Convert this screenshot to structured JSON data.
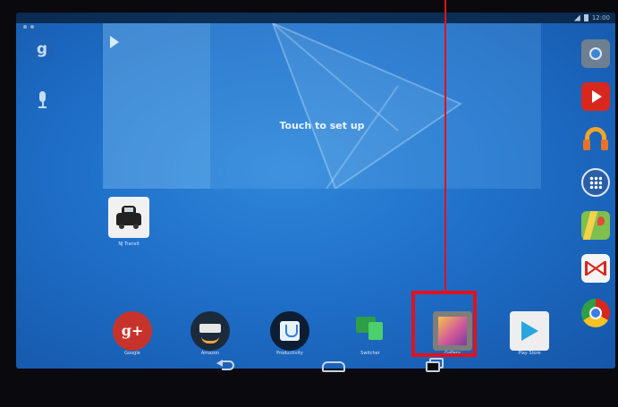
{
  "colors": {
    "wallpaper": "#1f6fc9",
    "highlight": "#e0121e",
    "frame": "#0a0a0e"
  },
  "status_bar": {
    "clock": "12:00"
  },
  "search_strip": {
    "google_letter": "g",
    "icons": [
      "google-search-icon",
      "mic-icon"
    ]
  },
  "widget": {
    "text": "Touch to set up",
    "icon": "play-icon"
  },
  "desktop_apps": [
    {
      "label": "NJ Transit",
      "icon": "taxi-icon"
    }
  ],
  "dock_right": [
    {
      "icon": "camera-icon"
    },
    {
      "icon": "youtube-icon"
    },
    {
      "icon": "play-music-icon"
    },
    {
      "icon": "all-apps-icon"
    },
    {
      "icon": "maps-icon"
    },
    {
      "icon": "gmail-icon"
    },
    {
      "icon": "chrome-icon"
    }
  ],
  "bottom_apps": [
    {
      "label": "Google",
      "icon": "google-plus-icon"
    },
    {
      "label": "Amazon",
      "icon": "amazon-icon"
    },
    {
      "label": "Productivity",
      "icon": "productivity-icon"
    },
    {
      "label": "Switcher",
      "icon": "switcher-icon"
    },
    {
      "label": "Gallery",
      "icon": "gallery-icon"
    },
    {
      "label": "Play Store",
      "icon": "play-store-icon"
    }
  ],
  "nav_bar": {
    "icons": [
      "back-icon",
      "home-icon",
      "recents-icon"
    ]
  },
  "annotation": {
    "target": "Gallery",
    "style": "red box with pointer line"
  }
}
